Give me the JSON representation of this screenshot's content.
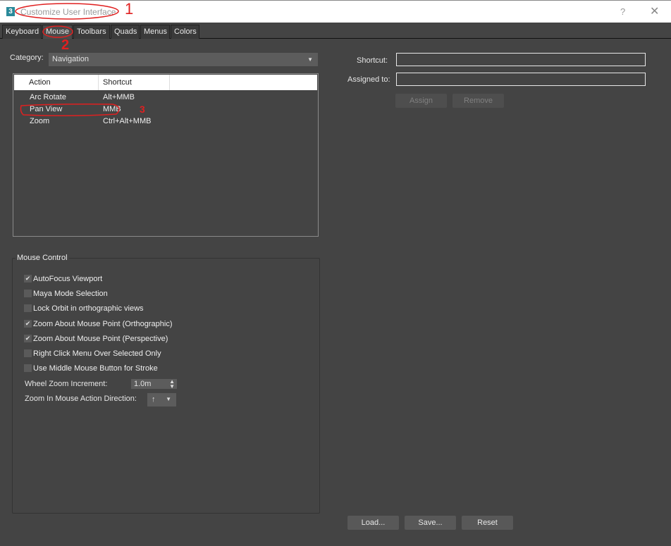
{
  "window": {
    "app_icon": "3",
    "title": "Customize User Interface",
    "help_label": "?",
    "close_label": "✕"
  },
  "tabs": [
    {
      "label": "Keyboard",
      "active": false
    },
    {
      "label": "Mouse",
      "active": true
    },
    {
      "label": "Toolbars",
      "active": false
    },
    {
      "label": "Quads",
      "active": false
    },
    {
      "label": "Menus",
      "active": false
    },
    {
      "label": "Colors",
      "active": false
    }
  ],
  "category": {
    "label": "Category:",
    "value": "Navigation",
    "arrow": "▼"
  },
  "action_list": {
    "columns": [
      "Action",
      "Shortcut"
    ],
    "rows": [
      {
        "action": "Arc Rotate",
        "shortcut": "Alt+MMB"
      },
      {
        "action": "Pan View",
        "shortcut": "MMB"
      },
      {
        "action": "Zoom",
        "shortcut": "Ctrl+Alt+MMB"
      }
    ]
  },
  "mouse_control": {
    "title": "Mouse Control",
    "options": [
      {
        "label": "AutoFocus Viewport",
        "checked": true
      },
      {
        "label": "Maya Mode Selection",
        "checked": false
      },
      {
        "label": "Lock Orbit in orthographic views",
        "checked": false
      },
      {
        "label": "Zoom About Mouse Point (Orthographic)",
        "checked": true
      },
      {
        "label": "Zoom About Mouse Point (Perspective)",
        "checked": true
      },
      {
        "label": "Right Click Menu Over Selected Only",
        "checked": false
      },
      {
        "label": "Use Middle Mouse Button for Stroke",
        "checked": false
      }
    ],
    "wheel_zoom_label": "Wheel Zoom Increment:",
    "wheel_zoom_value": "1.0m",
    "zoom_direction_label": "Zoom In Mouse Action Direction:",
    "zoom_direction_value": "↑",
    "check_glyph": "✔"
  },
  "shortcut_panel": {
    "shortcut_label": "Shortcut:",
    "shortcut_value": "",
    "assigned_label": "Assigned to:",
    "assigned_value": "",
    "assign_button": "Assign",
    "remove_button": "Remove"
  },
  "footer": {
    "load_button": "Load...",
    "save_button": "Save...",
    "reset_button": "Reset"
  },
  "annotations": [
    "1",
    "2",
    "3"
  ],
  "colors": {
    "background": "#444444",
    "annotation_red": "#e02020"
  }
}
